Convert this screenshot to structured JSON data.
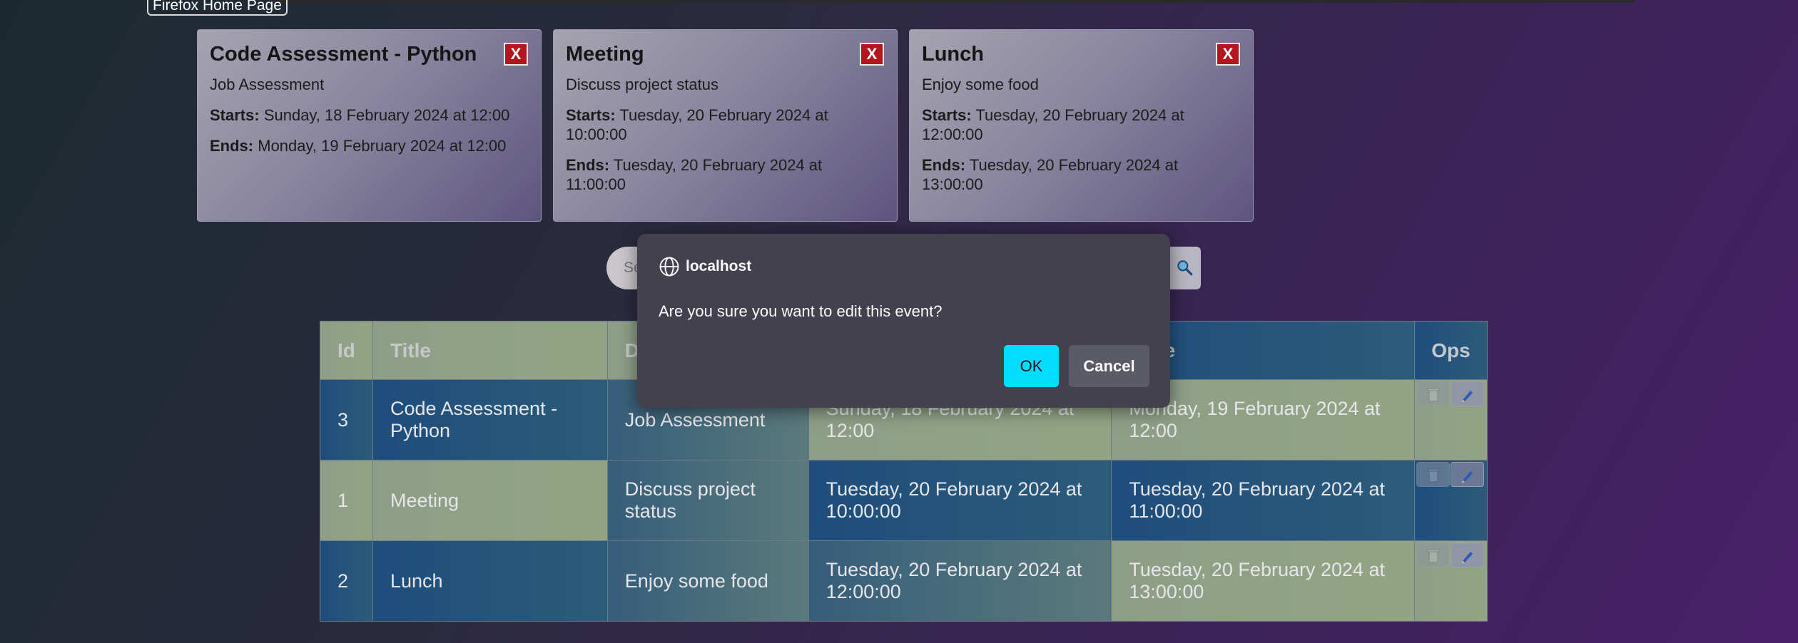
{
  "browser": {
    "home_link": "Firefox Home Page"
  },
  "cards": [
    {
      "title": "Code Assessment - Python",
      "close_label": "X",
      "description": "Job Assessment",
      "starts_label": "Starts:",
      "starts": "Sunday, 18 February 2024 at 12:00",
      "ends_label": "Ends:",
      "ends": "Monday, 19 February 2024 at 12:00"
    },
    {
      "title": "Meeting",
      "close_label": "X",
      "description": "Discuss project status",
      "starts_label": "Starts:",
      "starts": "Tuesday, 20 February 2024 at 10:00:00",
      "ends_label": "Ends:",
      "ends": "Tuesday, 20 February 2024 at 11:00:00"
    },
    {
      "title": "Lunch",
      "close_label": "X",
      "description": "Enjoy some food",
      "starts_label": "Starts:",
      "starts": "Tuesday, 20 February 2024 at 12:00:00",
      "ends_label": "Ends:",
      "ends": "Tuesday, 20 February 2024 at 13:00:00"
    }
  ],
  "search": {
    "placeholder": "Se"
  },
  "table": {
    "headers": {
      "id": "Id",
      "title": "Title",
      "description": "D",
      "start": "",
      "end": "Time",
      "ops": "Ops"
    },
    "rows": [
      {
        "id": "3",
        "title": "Code Assessment - Python",
        "description": "Job Assessment",
        "start": "Sunday, 18 February 2024 at 12:00",
        "end": "Monday, 19 February 2024 at 12:00"
      },
      {
        "id": "1",
        "title": "Meeting",
        "description": "Discuss project status",
        "start": "Tuesday, 20 February 2024 at 10:00:00",
        "end": "Tuesday, 20 February 2024 at 11:00:00"
      },
      {
        "id": "2",
        "title": "Lunch",
        "description": "Enjoy some food",
        "start": "Tuesday, 20 February 2024 at 12:00:00",
        "end": "Tuesday, 20 February 2024 at 13:00:00"
      }
    ]
  },
  "dialog": {
    "origin": "localhost",
    "message": "Are you sure you want to edit this event?",
    "ok_label": "OK",
    "cancel_label": "Cancel"
  },
  "colors": {
    "close_red": "#b3161d",
    "ok_cyan": "#00ddff",
    "dialog_bg": "#42414d",
    "header_green": "#8d9e86",
    "row_blue": "#1e4d7c"
  },
  "icons": {
    "delete": "trash-icon",
    "edit": "pencil-icon",
    "search": "search-icon",
    "origin": "globe-icon"
  }
}
